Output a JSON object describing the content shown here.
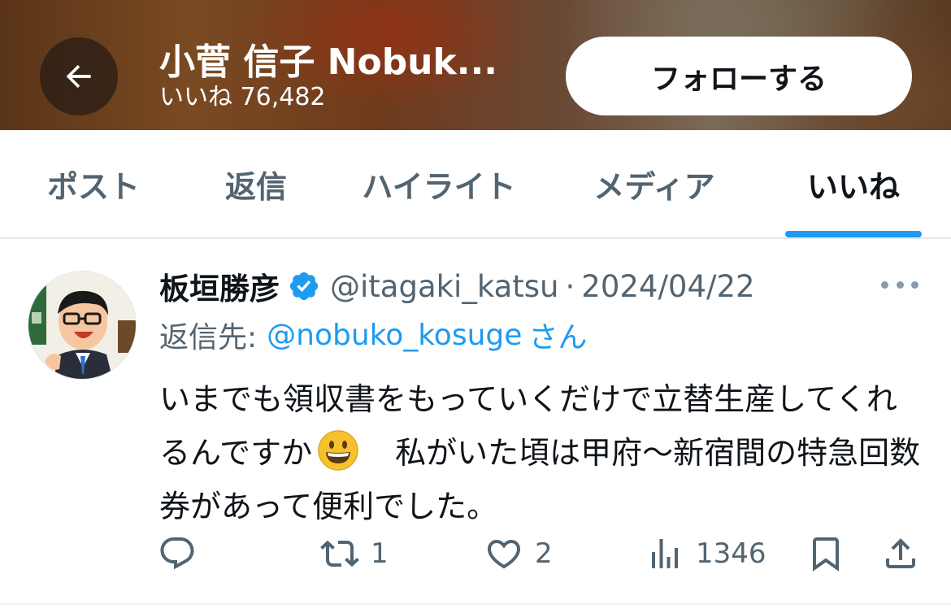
{
  "header": {
    "back_icon": "arrow-left-icon",
    "name": "小菅 信子 Nobuk...",
    "subtitle": "いいね 76,482",
    "follow_label": "フォローする"
  },
  "tabs": [
    {
      "label": "ポスト"
    },
    {
      "label": "返信"
    },
    {
      "label": "ハイライト"
    },
    {
      "label": "メディア"
    },
    {
      "label": "いいね",
      "active": true
    }
  ],
  "post": {
    "author": "板垣勝彦",
    "verified": true,
    "handle": "@itagaki_katsu",
    "separator": "·",
    "date": "2024/04/22",
    "reply_prefix": "返信先:",
    "reply_mention": "@nobuko_kosuge",
    "reply_suffix": "さん",
    "text_part1": "いまでも領収書をもっていくだけで立替生産してくれるんですか",
    "emoji": "grinning-face",
    "text_part2": "　私がいた頃は甲府〜新宿間の特急回数券があって便利でした。",
    "actions": {
      "reply_count": "",
      "repost_count": "1",
      "like_count": "2",
      "views_count": "1346"
    }
  },
  "colors": {
    "accent": "#1d9bf0",
    "text_primary": "#0f1419",
    "text_secondary": "#536471"
  }
}
